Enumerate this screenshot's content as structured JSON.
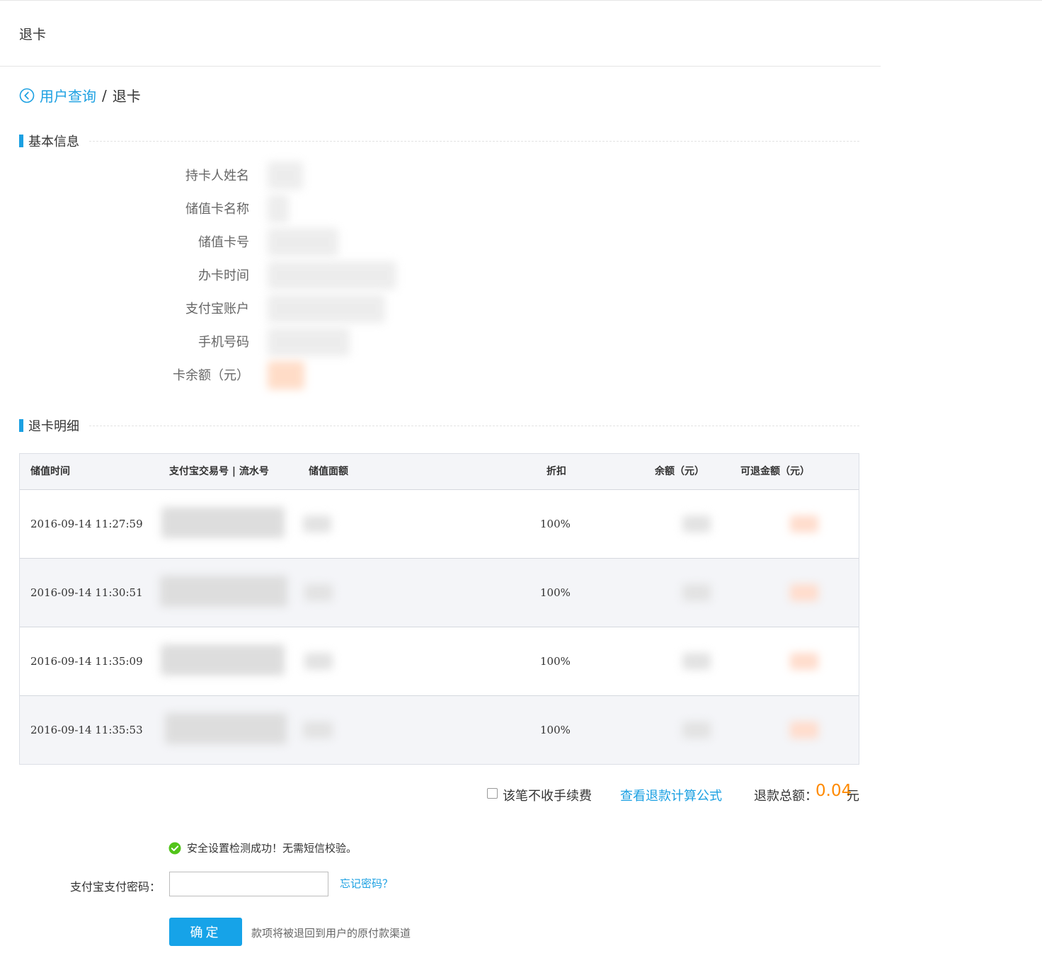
{
  "page": {
    "title": "退卡"
  },
  "breadcrumb": {
    "parent": "用户查询",
    "separator": "/",
    "current": "退卡"
  },
  "basic_info": {
    "section_title": "基本信息",
    "fields": [
      {
        "label": "持卡人姓名"
      },
      {
        "label": "储值卡名称"
      },
      {
        "label": "储值卡号"
      },
      {
        "label": "办卡时间"
      },
      {
        "label": "支付宝账户"
      },
      {
        "label": "手机号码"
      },
      {
        "label": "卡余额（元）"
      }
    ]
  },
  "refund_detail": {
    "section_title": "退卡明细",
    "columns": [
      "储值时间",
      "支付宝交易号 | 流水号",
      "储值面额",
      "折扣",
      "余额（元）",
      "可退金额（元）"
    ],
    "rows": [
      {
        "time": "2016-09-14 11:27:59",
        "discount": "100%"
      },
      {
        "time": "2016-09-14 11:30:51",
        "discount": "100%"
      },
      {
        "time": "2016-09-14 11:35:09",
        "discount": "100%"
      },
      {
        "time": "2016-09-14 11:35:53",
        "discount": "100%"
      }
    ]
  },
  "summary": {
    "no_fee_label": "该笔不收手续费",
    "formula_link": "查看退款计算公式",
    "total_label": "退款总额：",
    "total_value": "0.04",
    "total_unit": "元"
  },
  "security": {
    "message": "安全设置检测成功！无需短信校验。"
  },
  "payment": {
    "password_label": "支付宝支付密码：",
    "password_value": "",
    "forgot_link": "忘记密码？",
    "confirm_label": "确定",
    "note": "款项将被退回到用户的原付款渠道"
  },
  "colors": {
    "accent": "#1ba0e2",
    "total": "#ff8a00",
    "success": "#52c41a"
  }
}
